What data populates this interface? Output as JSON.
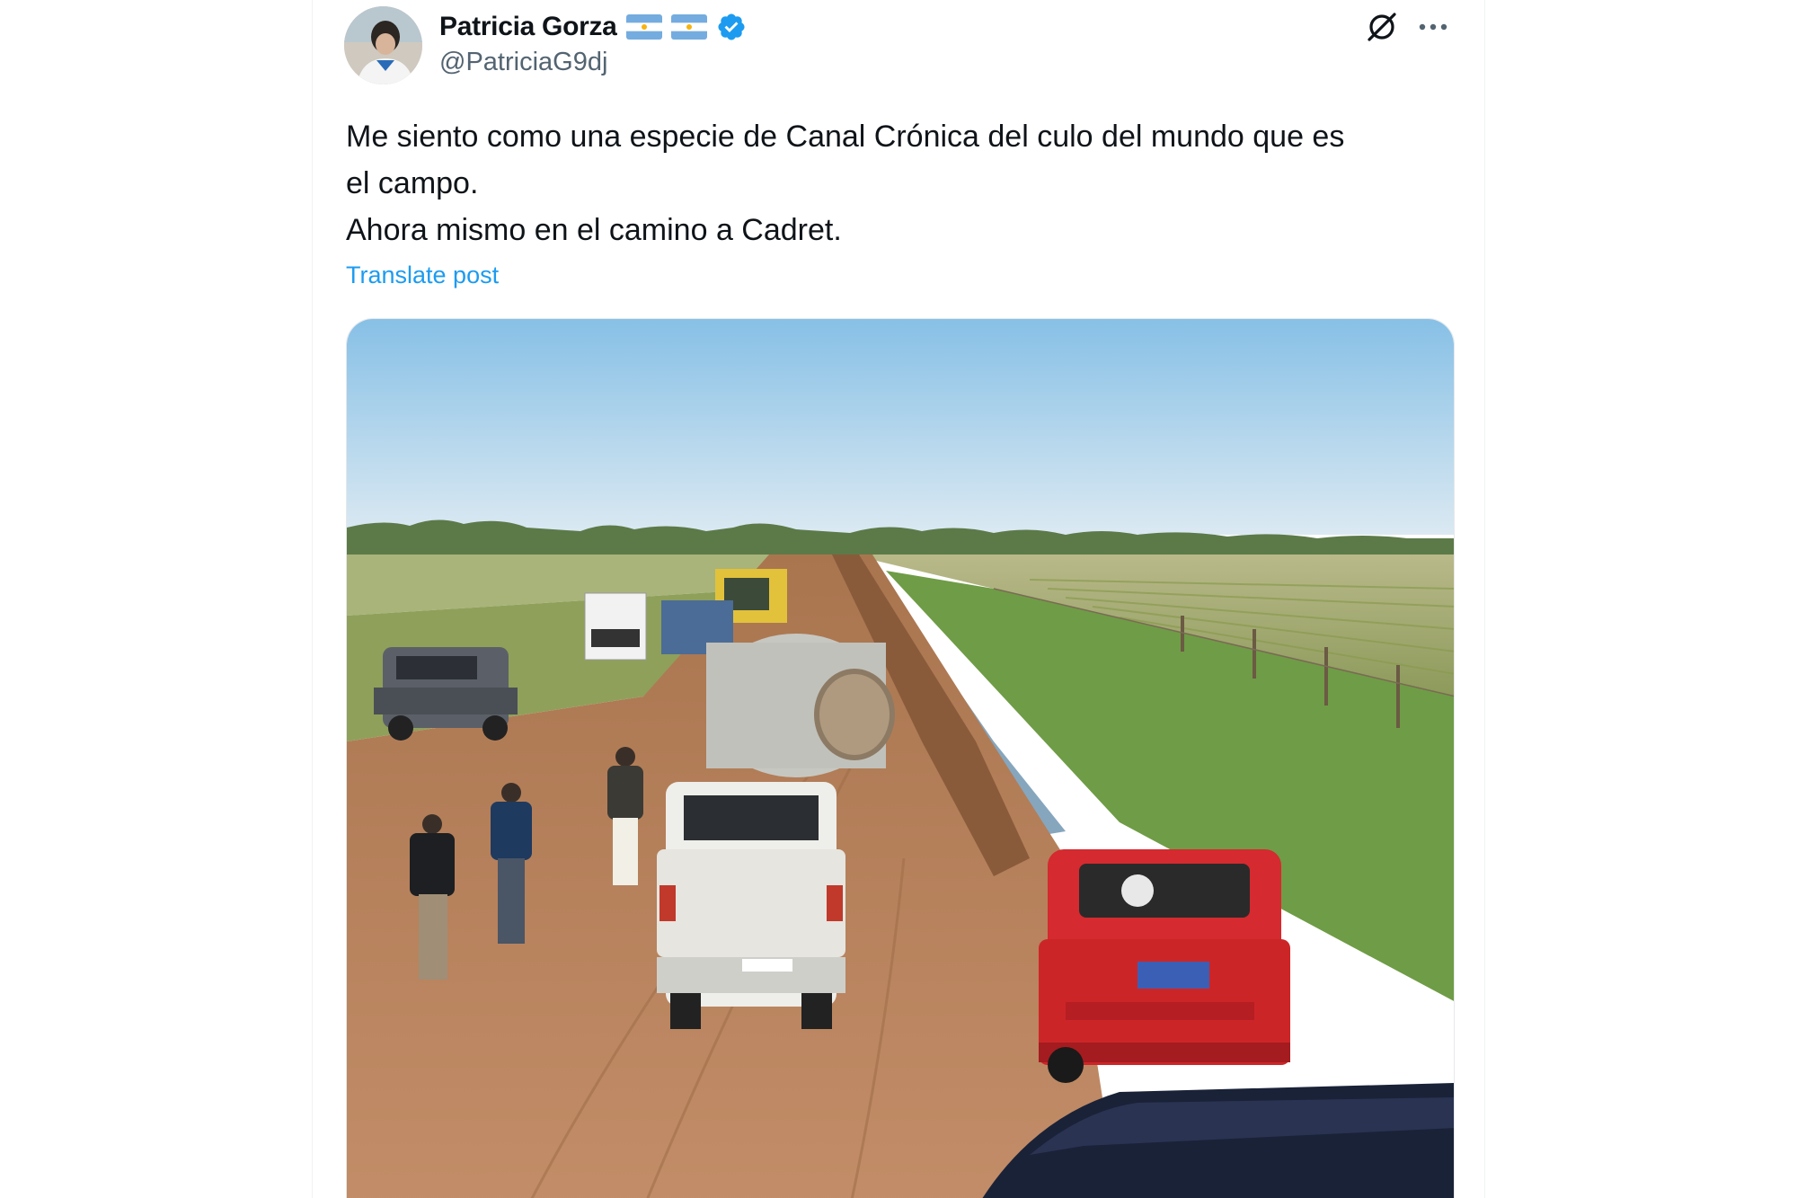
{
  "tweet": {
    "author": {
      "display_name": "Patricia Gorza",
      "handle": "@PatriciaG9dj",
      "flags": [
        "argentina-flag-icon",
        "argentina-flag-icon"
      ],
      "verified": true,
      "avatar": "avatar"
    },
    "text_lines": [
      "Me siento como una especie de Canal Crónica del culo del mundo que es",
      "el campo.",
      "Ahora mismo en el camino a Cadret."
    ],
    "translate_label": "Translate post",
    "actions": {
      "grok_icon": "grok-icon",
      "more_icon": "more-options-icon"
    },
    "media": {
      "type": "photo"
    }
  },
  "colors": {
    "text_primary": "#0f1419",
    "text_secondary": "#536471",
    "link": "#1d9bf0",
    "verified_badge": "#1d9bf0",
    "border": "#eff3f4"
  }
}
